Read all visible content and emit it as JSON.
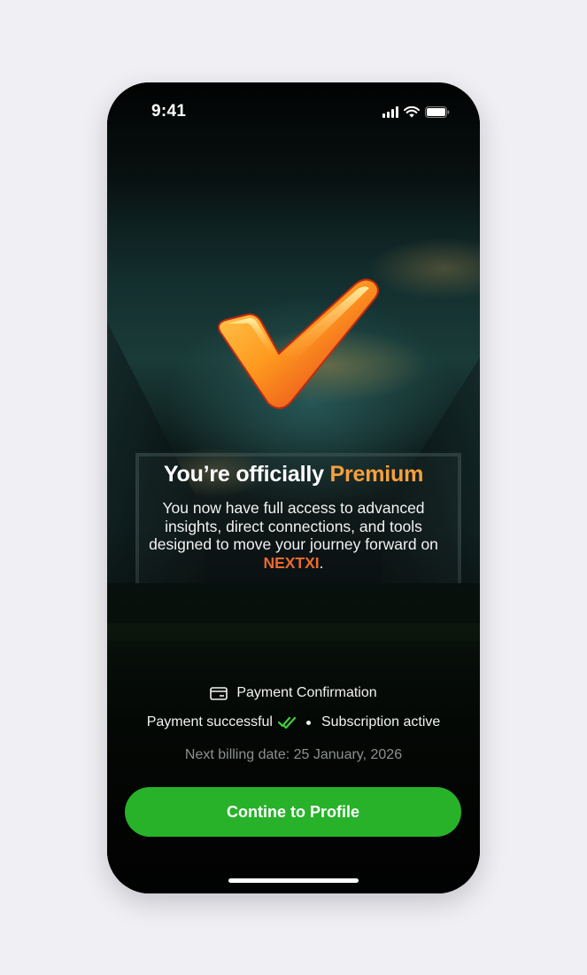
{
  "status_bar": {
    "time": "9:41"
  },
  "hero": {
    "title_prefix": "You’re officially ",
    "title_accent": "Premium",
    "description_prefix": "You now have full access to advanced insights, direct connections, and tools designed to move your journey forward on ",
    "brand": "NEXTXI",
    "description_suffix": "."
  },
  "payment": {
    "title": "Payment Confirmation",
    "status_success": "Payment successful",
    "status_subscription": "Subscription active",
    "billing": "Next billing date: 25 January, 2026"
  },
  "cta": {
    "label": "Contine to Profile"
  },
  "colors": {
    "accent": "#f6a03e",
    "brand": "#e96a2c",
    "button": "#27b22a",
    "success_check": "#3ccf3c"
  },
  "icons": [
    "signal-icon",
    "wifi-icon",
    "battery-icon",
    "checkmark-icon",
    "card-icon",
    "double-check-icon"
  ]
}
